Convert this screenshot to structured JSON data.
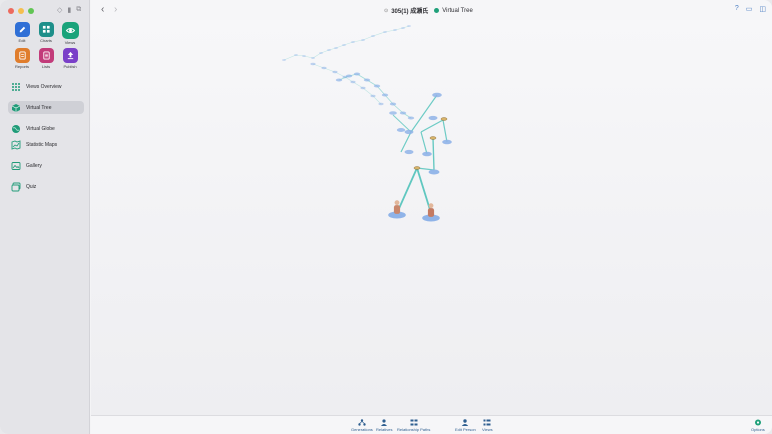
{
  "window": {
    "title_pin": "⊙",
    "person": "305(1) 成瀬氏",
    "view": "Virtual Tree"
  },
  "apps": [
    {
      "label": "Edit",
      "color": "#2f6fd6",
      "icon": "pencil-icon"
    },
    {
      "label": "Charts",
      "color": "#1e8f8a",
      "icon": "charts-icon"
    },
    {
      "label": "Views",
      "color": "#19a37a",
      "icon": "eye-icon",
      "active": true
    },
    {
      "label": "Reports",
      "color": "#e07d2c",
      "icon": "reports-icon"
    },
    {
      "label": "Lists",
      "color": "#c23b7a",
      "icon": "lists-icon"
    },
    {
      "label": "Publish",
      "color": "#7a3fc8",
      "icon": "upload-icon"
    }
  ],
  "nav": {
    "overview": "Views Overview",
    "virtual_tree": "Virtual Tree",
    "virtual_globe": "Virtual Globe",
    "statistic_maps": "Statistic Maps",
    "gallery": "Gallery",
    "quiz": "Quiz"
  },
  "bottom": {
    "generations": "Generations",
    "relatives": "Relatives",
    "relationship_paths": "Relationship Paths",
    "edit_person": "Edit Person",
    "views": "Views",
    "options": "Options"
  },
  "colors": {
    "accent": "#1fa07a",
    "link": "#2f5f90",
    "node": "#8fb3e8",
    "edge": "#5fc7c0"
  }
}
